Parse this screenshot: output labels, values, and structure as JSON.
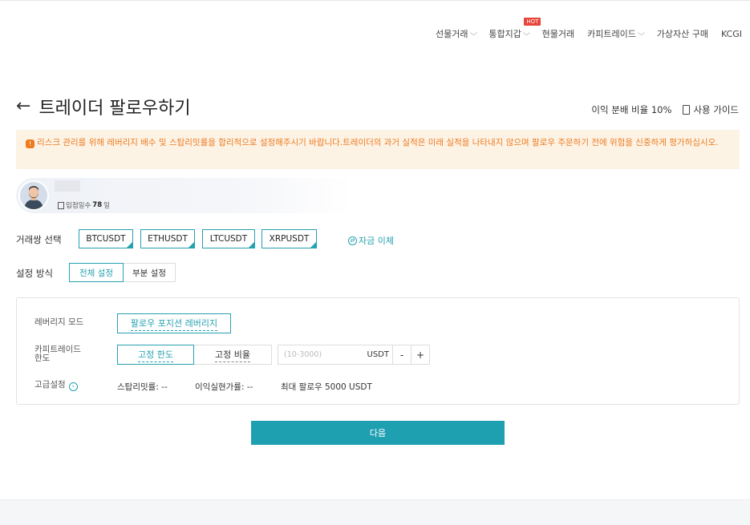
{
  "nav": {
    "items": [
      {
        "label": "선물거래",
        "dropdown": true
      },
      {
        "label": "통합지갑",
        "dropdown": true,
        "badge": "HOT"
      },
      {
        "label": "현물거래",
        "dropdown": false
      },
      {
        "label": "카피트레이드",
        "dropdown": true
      },
      {
        "label": "가상자산 구매",
        "dropdown": false
      },
      {
        "label": "KCGI",
        "dropdown": false
      }
    ]
  },
  "header": {
    "back_glyph": "←",
    "title": "트레이더 팔로우하기",
    "profit_share": "이익 분배 비율 10%",
    "guide_label": "사용 가이드"
  },
  "warning": {
    "icon_glyph": "!",
    "text": "리스크 관리를 위해 레버리지 배수 및 스탑리밋률을 합리적으로 설정해주시기 바랍니다.트레이더의 과거 실적은 미래 실적을 나타내지 않으며 팔로우 주문하기 전에 위험을 신중하게 평가하십시오."
  },
  "trader": {
    "days_label": "입점일수",
    "days_value": "78",
    "days_unit": "일"
  },
  "pairs": {
    "label": "거래쌍 선택",
    "items": [
      "BTCUSDT",
      "ETHUSDT",
      "LTCUSDT",
      "XRPUSDT"
    ],
    "transfer_label": "자금 이체",
    "transfer_glyph": "⇄"
  },
  "mode": {
    "label": "설정 방식",
    "full": "전체 설정",
    "partial": "부분 설정",
    "active": "전체 설정"
  },
  "settings": {
    "leverage_label": "레버리지 모드",
    "leverage_value": "팔로우 포지션 레버리지",
    "limit_label_1": "카피트레이드",
    "limit_label_2": "한도",
    "fixed_amount": "고정 한도",
    "fixed_ratio": "고정 비율",
    "input_placeholder": "(10-3000)",
    "unit": "USDT",
    "minus": "-",
    "plus": "+",
    "advanced_label": "고급설정",
    "advanced_glyph": "›",
    "stop_limit": "스탑리밋률: --",
    "take_profit": "이익실현가률: --",
    "max_follow": "최대 팔로우 5000 USDT"
  },
  "next_button": "다음",
  "colors": {
    "accent": "#1fa0b1",
    "warning_bg": "#fdf3e5",
    "warning_text": "#ec7b22",
    "hot_badge": "#e8443a"
  }
}
